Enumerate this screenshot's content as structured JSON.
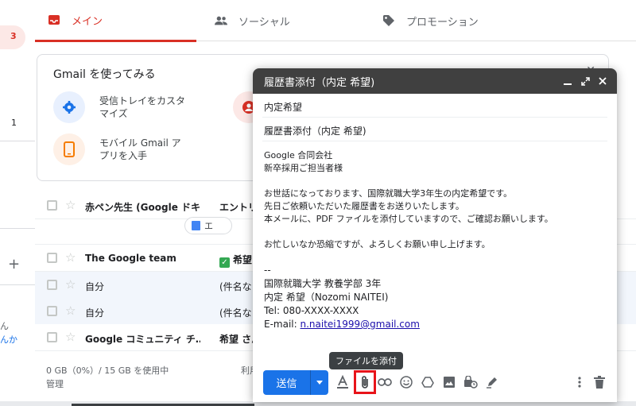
{
  "sidebar": {
    "count_main": "3",
    "count_other": "1",
    "plus": "+",
    "frag1": "ん",
    "frag2": "んか"
  },
  "tabs": [
    {
      "label": "メイン",
      "icon": "inbox-icon"
    },
    {
      "label": "ソーシャル",
      "icon": "people-icon"
    },
    {
      "label": "プロモーション",
      "icon": "tag-icon"
    }
  ],
  "card": {
    "title": "Gmail を使ってみる",
    "item1": "受信トレイをカスタマイズ",
    "item2": "モバイル Gmail アプリを入手"
  },
  "emails": [
    {
      "sender": "赤ペン先生 (Google ドキ…",
      "subject": "エントリ",
      "chip": "エ",
      "unread": true
    },
    {
      "sender": "The Google team",
      "subject": "希望",
      "unread": true
    },
    {
      "sender": "自分",
      "subject": "(件名な",
      "unread": false
    },
    {
      "sender": "自分",
      "subject": "(件名な",
      "unread": false
    },
    {
      "sender": "Google コミュニティ チ…",
      "subject": "希望 さん",
      "unread": true
    }
  ],
  "footer": {
    "storage": "0 GB（0%）/ 15 GB を使用中",
    "manage": "管理",
    "terms": "利用"
  },
  "compose": {
    "title": "履歴書添付（内定 希望)",
    "to": "内定希望",
    "subject": "履歴書添付（内定 希望)",
    "body": [
      "Google 合同会社",
      "新卒採用ご担当者様",
      "",
      "お世話になっております、国際就職大学3年生の内定希望です。",
      "先日ご依頼いただいた履歴書をお送りいたします。",
      "本メールに、PDF ファイルを添付していますので、ご確認お願いします。",
      "",
      "お忙しいなか恐縮ですが、よろしくお願い申し上げます。"
    ],
    "sig_sep": "--",
    "sig_org": "国際就職大学 教養学部 3年",
    "sig_name": "内定 希望（Nozomi NAITEI)",
    "sig_tel": "Tel: 080-XXXX-XXXX",
    "sig_email_label": "E-mail: ",
    "sig_email": "n.naitei1999@gmail.com",
    "send_label": "送信",
    "tooltip": "ファイルを添付"
  },
  "colors": {
    "accent": "#d93025",
    "send": "#1a73e8",
    "highlight": "#e8141a"
  }
}
